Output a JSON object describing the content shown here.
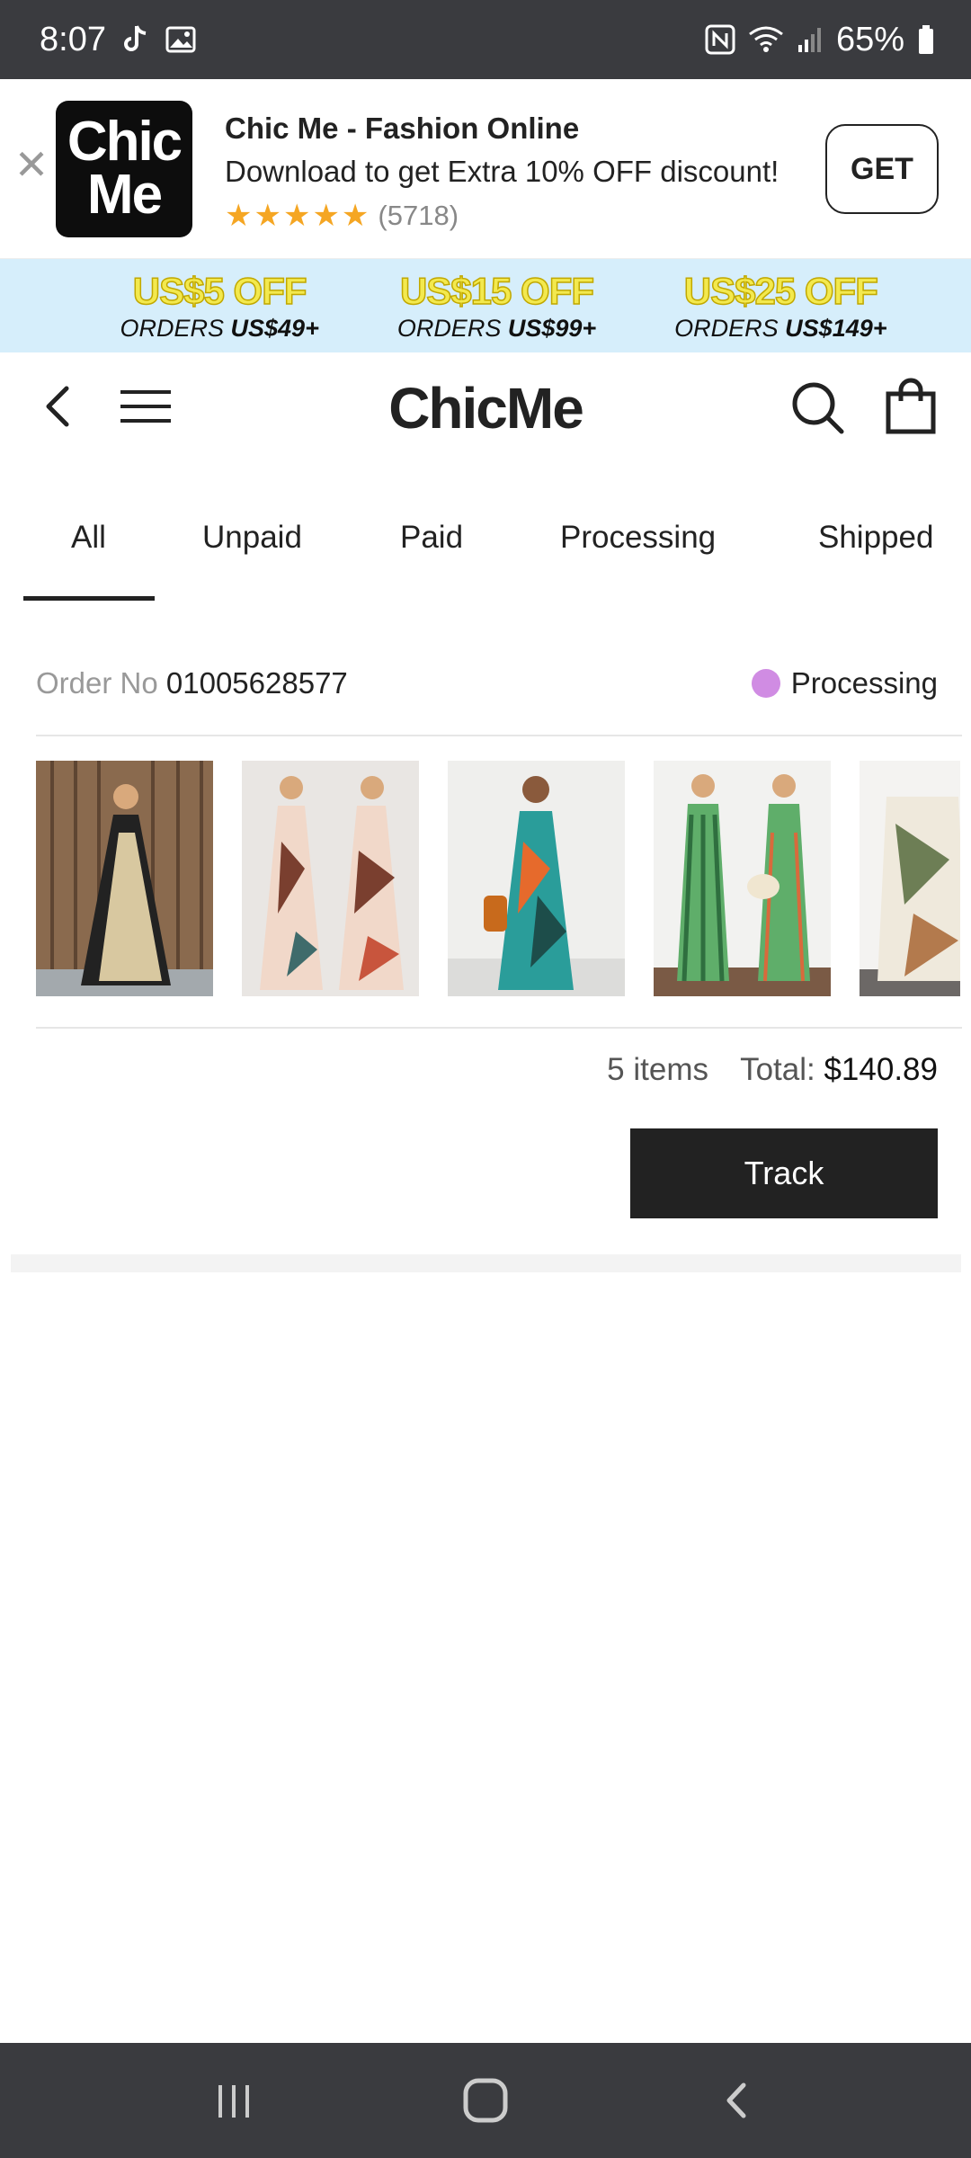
{
  "status_bar": {
    "time": "8:07",
    "battery": "65%",
    "icons": [
      "tiktok-icon",
      "gallery-icon",
      "nfc-icon",
      "wifi-icon",
      "signal-icon",
      "battery-icon"
    ]
  },
  "promo": {
    "title": "Chic Me - Fashion Online",
    "subtitle": "Download to get Extra 10% OFF discount!",
    "stars": "★★★★★",
    "rating_count": "(5718)",
    "get_label": "GET",
    "logo_line1": "Chic",
    "logo_line2": "Me"
  },
  "discounts": [
    {
      "amount": "US$5 OFF",
      "cond_prefix": "ORDERS ",
      "cond_value": "US$49+"
    },
    {
      "amount": "US$15 OFF",
      "cond_prefix": "ORDERS ",
      "cond_value": "US$99+"
    },
    {
      "amount": "US$25 OFF",
      "cond_prefix": "ORDERS ",
      "cond_value": "US$149+"
    }
  ],
  "header": {
    "logo": "ChicMe"
  },
  "tabs": [
    "All",
    "Unpaid",
    "Paid",
    "Processing",
    "Shipped"
  ],
  "active_tab": "All",
  "order": {
    "order_no_label": "Order No",
    "order_no": "01005628577",
    "status": "Processing",
    "status_color": "#d08ce3",
    "items_count": "5 items",
    "total_label": "Total:",
    "total_value": "$140.89",
    "track_label": "Track"
  },
  "colors": {
    "status_bar": "#3a3b3f",
    "discount_strip": "#d6eefb",
    "star": "#f5a623",
    "button_dark": "#222222"
  }
}
